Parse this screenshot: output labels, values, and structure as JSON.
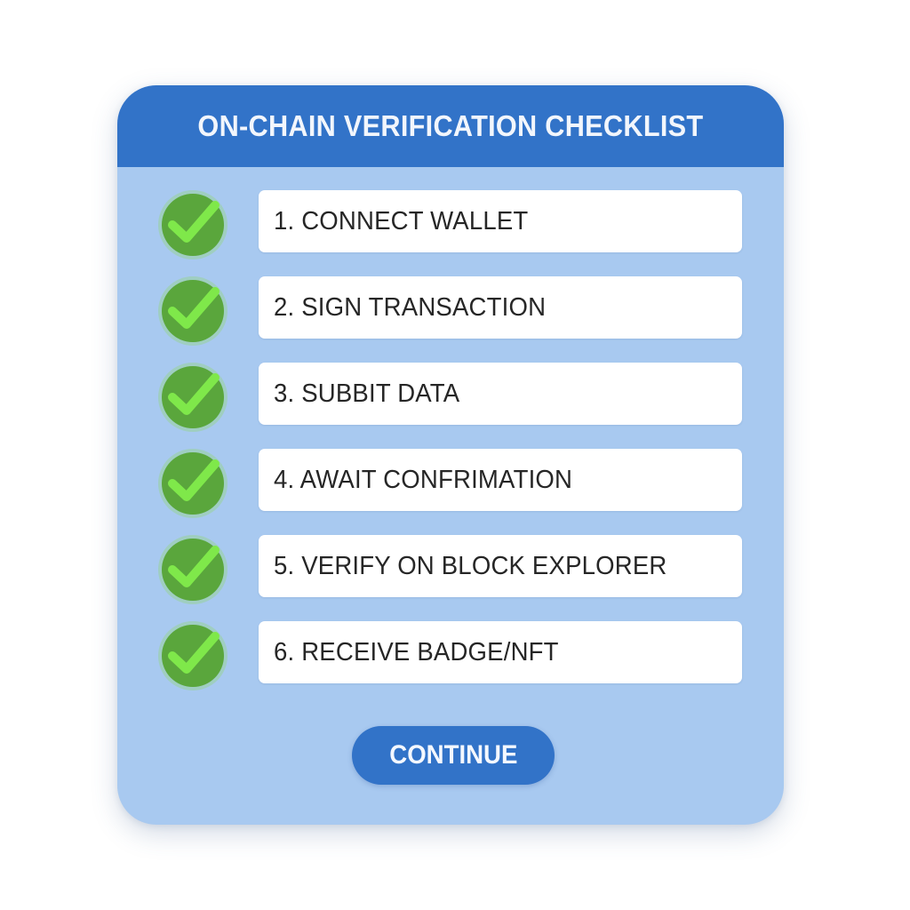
{
  "checklist": {
    "title": "ON-CHAIN VERIFICATION CHECKLIST",
    "items": [
      {
        "label": "1. CONNECT WALLET",
        "checked": true
      },
      {
        "label": "2. SIGN TRANSACTION",
        "checked": true
      },
      {
        "label": "3. SUBBIT DATA",
        "checked": true
      },
      {
        "label": "4. AWAIT CONFRIMATION",
        "checked": true
      },
      {
        "label": "5. VERIFY ON BLOCK EXPLORER",
        "checked": true
      },
      {
        "label": "6. RECEIVE BADGE/NFT",
        "checked": true
      }
    ],
    "continue_label": "CONTINUE"
  },
  "colors": {
    "header": "#3273c8",
    "panel": "#a8c9f0",
    "check_circle": "#5aa63c",
    "check_mark": "#7fe84a",
    "button": "#3273c8"
  }
}
